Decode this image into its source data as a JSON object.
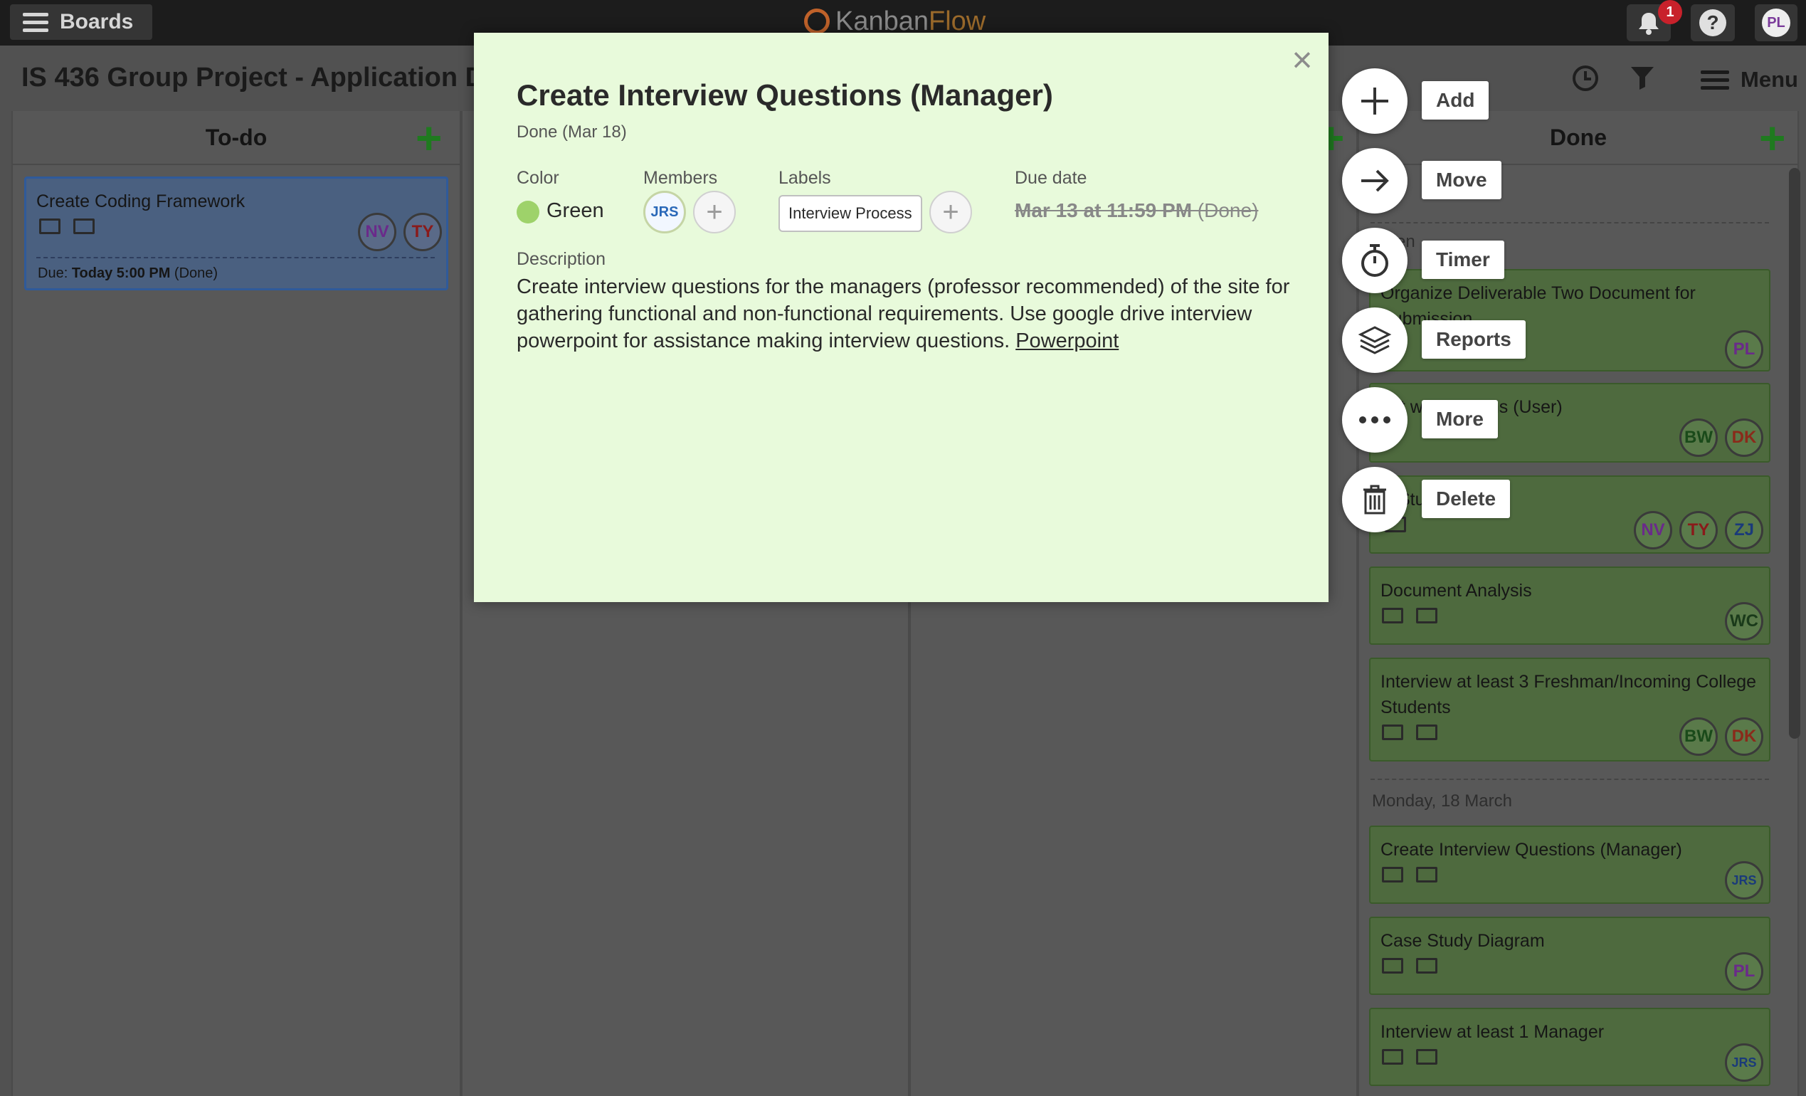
{
  "topbar": {
    "boards_label": "Boards",
    "logo_kanban": "Kanban",
    "logo_flow": "Flow",
    "notif_count": "1",
    "help_label": "?",
    "user_initials": "PL"
  },
  "header": {
    "board_title": "IS 436 Group Project - Application De",
    "menu_label": "Menu"
  },
  "columns": {
    "todo": {
      "title": "To-do"
    },
    "done": {
      "title": "Done"
    }
  },
  "todo_cards": [
    {
      "title": "Create Coding Framework",
      "due_prefix": "Due: ",
      "due_bold": "Today 5:00 PM",
      "due_suffix": " (Done)",
      "members": [
        "NV",
        "TY"
      ]
    }
  ],
  "done_column": {
    "partial_label_1": "y",
    "partial_label_2": "en",
    "cards": [
      {
        "title": "Organize Deliverable Two Document for Submission",
        "members": [
          "PL"
        ]
      },
      {
        "title": "eat      w Questions (User)",
        "members": [
          "BW",
          "DK"
        ]
      },
      {
        "title": "vi            Studies",
        "members": [
          "NV",
          "TY",
          "ZJ"
        ]
      },
      {
        "title": "Document Analysis",
        "members": [
          "WC"
        ]
      },
      {
        "title": "Interview at least 3 Freshman/Incoming College Students",
        "members": [
          "BW",
          "DK"
        ]
      }
    ],
    "day2": "Monday, 18 March",
    "cards2": [
      {
        "title": "Create Interview Questions (Manager)",
        "members": [
          "JRS"
        ]
      },
      {
        "title": "Case Study Diagram",
        "members": [
          "PL"
        ]
      },
      {
        "title": "Interview at least 1 Manager",
        "members": [
          "JRS"
        ]
      }
    ]
  },
  "modal": {
    "title": "Create Interview Questions (Manager)",
    "status": "Done (Mar 18)",
    "color_label": "Color",
    "color_value": "Green",
    "members_label": "Members",
    "member": "JRS",
    "labels_label": "Labels",
    "label_chip": "Interview Process",
    "due_label": "Due date",
    "due_value": "Mar 13 at 11:59 PM",
    "due_suffix": " (Done)",
    "description_label": "Description",
    "description": "Create interview questions for the managers (professor recommended) of the site for gathering functional and non-functional requirements. Use google drive interview powerpoint for assistance making interview questions. ",
    "description_link": "Powerpoint"
  },
  "actions": {
    "add": "Add",
    "move": "Move",
    "timer": "Timer",
    "reports": "Reports",
    "more": "More",
    "delete": "Delete"
  },
  "colors": {
    "modal_bg": "#e8fadb",
    "done_green": "#4e6a3e",
    "accent_green": "#1f7a1f",
    "badge_red": "#c8212b"
  }
}
